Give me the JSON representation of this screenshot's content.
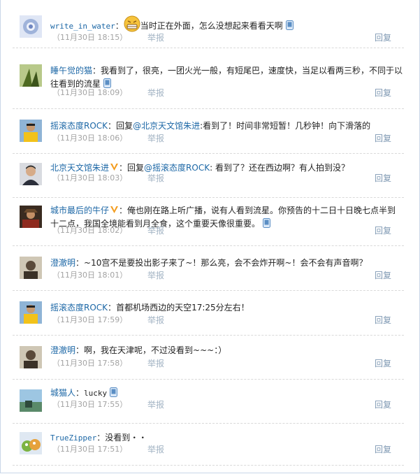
{
  "comments": [
    {
      "user": "write_in_water",
      "sep": "：",
      "text": "当时正在外面，怎么没想起来看看天啊",
      "time": "（11月30日 18:15）",
      "report": "举报",
      "reply": "回复"
    },
    {
      "user": "睡午觉的猫",
      "sep": "：",
      "text": "我看到了，很亮，一团火光一般，有短尾巴，速度快，当足以看两三秒，不同于以往看到的流星",
      "time": "（11月30日 18:09）",
      "report": "举报",
      "reply": "回复"
    },
    {
      "user": "摇滚态度ROCK",
      "sep": "：",
      "pre": "回复",
      "mention": "@北京天文馆朱进",
      "text": ":看到了！时间非常短暂！几秒钟！向下滑落的",
      "time": "（11月30日 18:06）",
      "report": "举报",
      "reply": "回复"
    },
    {
      "user": "北京天文馆朱进",
      "sep": "：",
      "pre": "回复",
      "mention": "@摇滚态度ROCK",
      "text": ": 看到了？还在西边啊？有人拍到没？",
      "time": "（11月30日 18:03）",
      "report": "举报",
      "reply": "回复"
    },
    {
      "user": "城市最后的牛仔",
      "sep": "：",
      "text": "俺也刚在路上听广播，说有人看到流星。你预告的十二日十日晚七点半到十二点，我国全境能看到月全食，这个重要天像很重要。",
      "time": "（11月30日 18:02）",
      "report": "举报",
      "reply": "回复"
    },
    {
      "user": "澄澈明",
      "sep": "：",
      "text": "~10宫不是要投出影子来了~！那么亮，会不会炸开啊~！会不会有声音啊？",
      "time": "（11月30日 18:01）",
      "report": "举报",
      "reply": "回复"
    },
    {
      "user": "摇滚态度ROCK",
      "sep": "：",
      "text": "首都机场西边的天空17:25分左右！",
      "time": "（11月30日 17:59）",
      "report": "举报",
      "reply": "回复"
    },
    {
      "user": "澄澈明",
      "sep": "：",
      "text": "啊，我在天津呢，不过没看到~~~：）",
      "time": "（11月30日 17:58）",
      "report": "举报",
      "reply": "回复"
    },
    {
      "user": "城猫人",
      "sep": "：",
      "text": "lucky",
      "time": "（11月30日 17:55）",
      "report": "举报",
      "reply": "回复"
    },
    {
      "user": "TrueZipper",
      "sep": "：",
      "text": "没看到・・",
      "time": "（11月30日 17:51）",
      "report": "举报",
      "reply": "回复"
    }
  ],
  "colors": {
    "link": "#1c67a6",
    "time": "#a3a3a3",
    "report": "#a3b4c4",
    "reply": "#7f99b3",
    "vbadge": "#f39c1f"
  }
}
